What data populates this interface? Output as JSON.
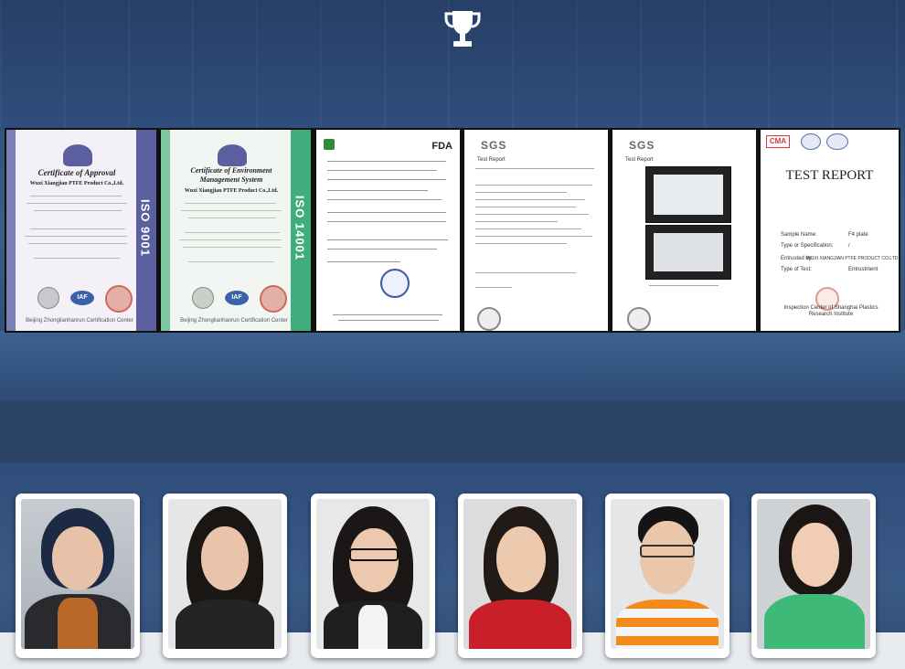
{
  "certificates": [
    {
      "title": "Certificate of Approval",
      "company": "Wuxi Xiangjian PTFE Product Co.,Ltd.",
      "standard": "ISO 9001",
      "logos": [
        "IAF"
      ],
      "issuer": "Beijing Zhonglianhanrun Certification Center",
      "color": "#5b5fa0"
    },
    {
      "title": "Certificate of Environment Management System",
      "company": "Wuxi Xiangjian PTFE Product Co.,Ltd.",
      "standard": "ISO 14001",
      "logos": [
        "IAF"
      ],
      "issuer": "Beijing Zhonglianhanrun Certification Center",
      "color": "#3fae7c"
    },
    {
      "mark": "FDA"
    },
    {
      "mark": "SGS",
      "label": "Test Report"
    },
    {
      "mark": "SGS",
      "label": "Test Report"
    },
    {
      "marks": [
        "CMA"
      ],
      "title": "TEST REPORT",
      "fields": [
        {
          "label": "Sample Name:",
          "value": "F4 plate"
        },
        {
          "label": "Type or Specification:",
          "value": "/"
        },
        {
          "label": "Entrusted by:",
          "value": "WUXI XIANGJIAN PTFE PRODUCT CO.LTD"
        },
        {
          "label": "Type of Test:",
          "value": "Entrustment"
        }
      ],
      "issuer": "Inspection Center of Shanghai Plastics Research Institute"
    }
  ],
  "icons": {
    "trophy": "trophy-icon"
  },
  "staff_photos": 6
}
